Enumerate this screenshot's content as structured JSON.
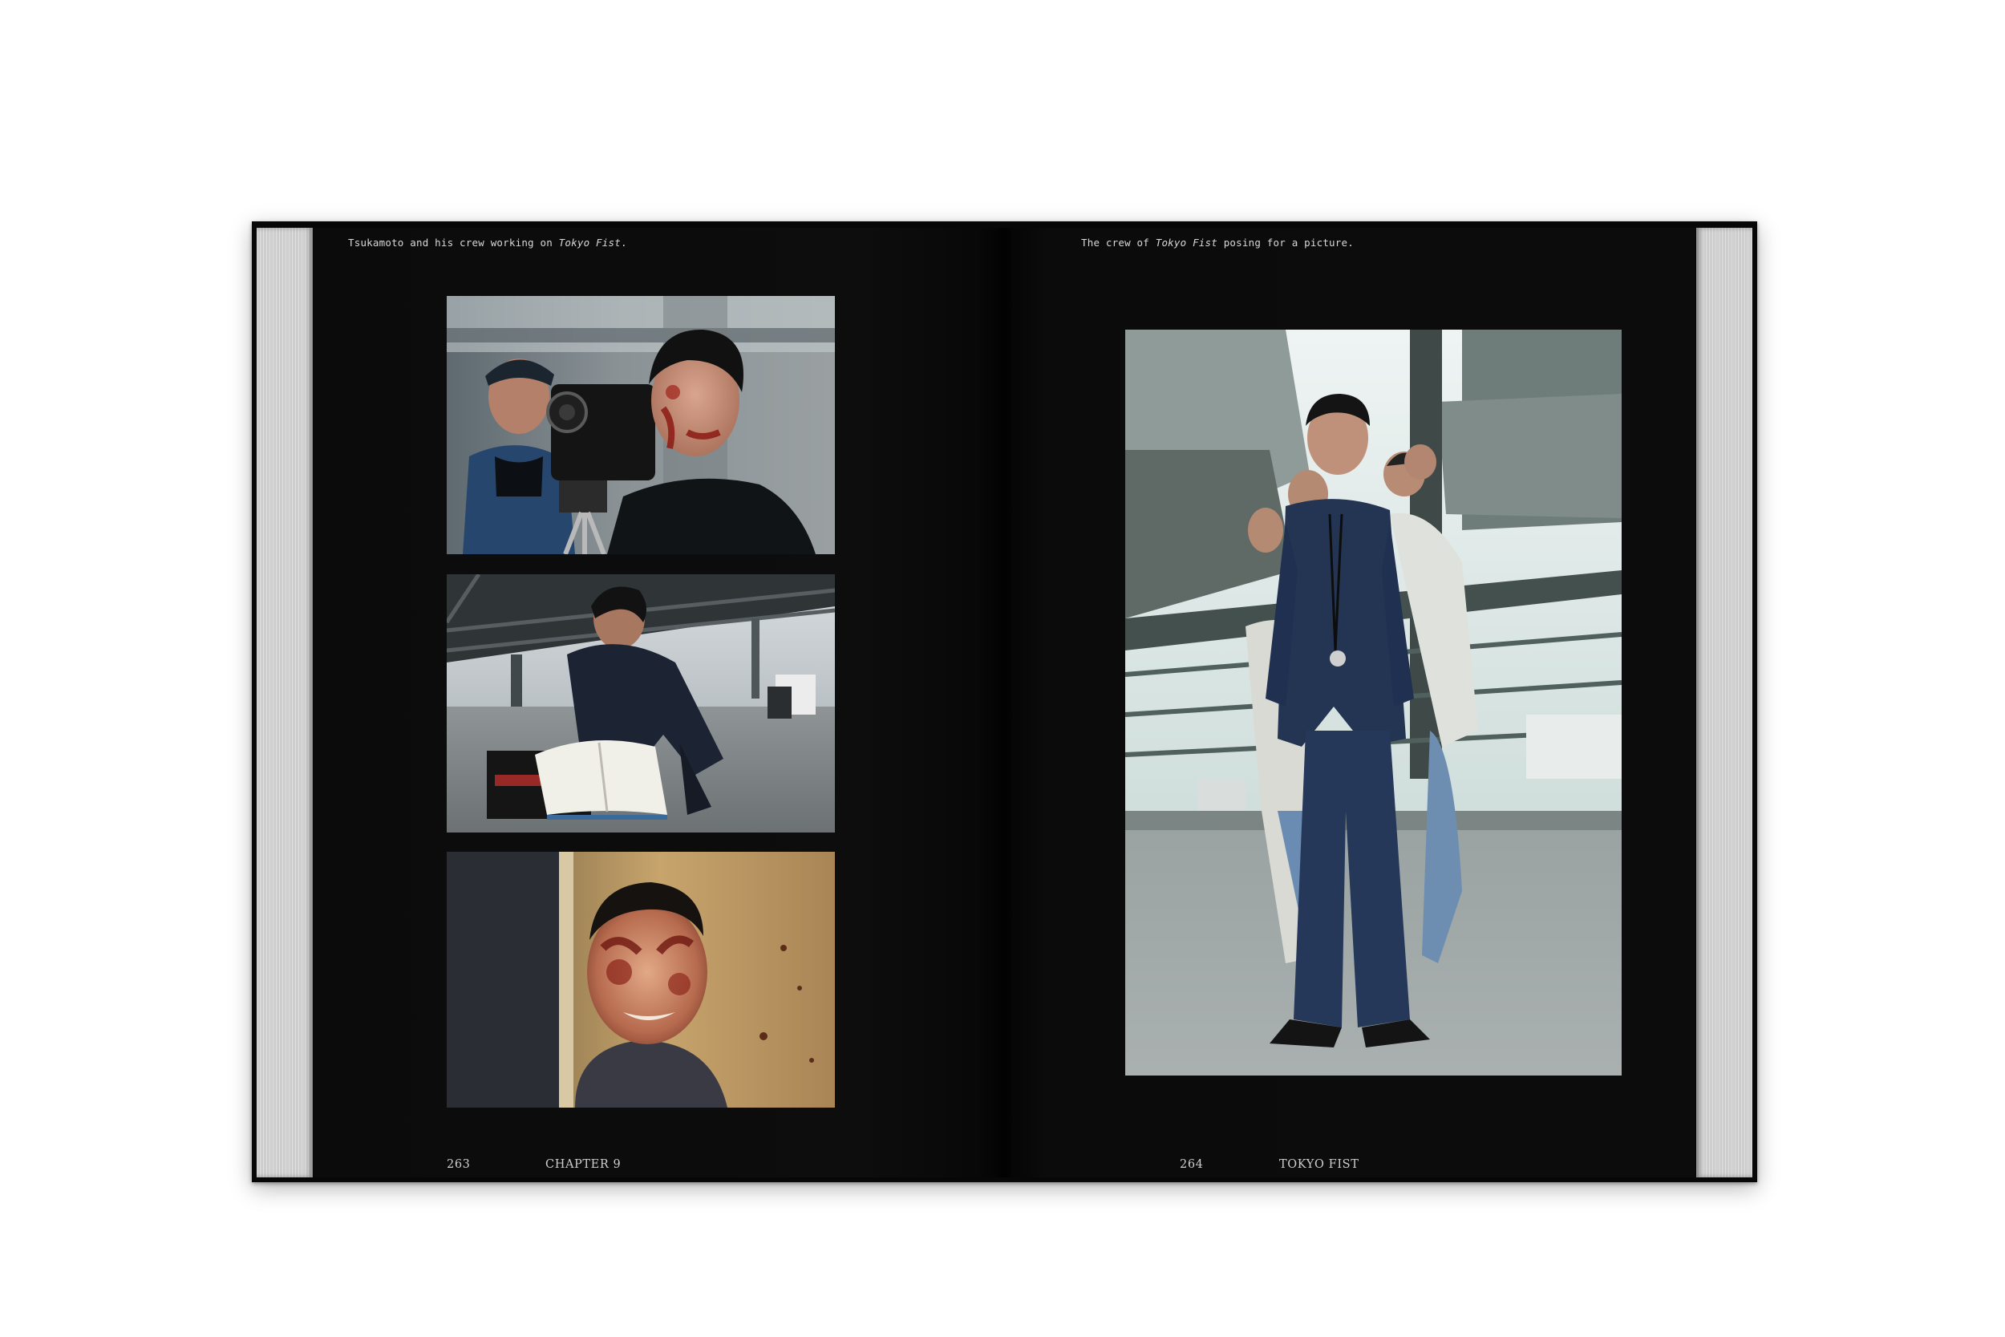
{
  "left_page": {
    "caption": {
      "before": "Tsukamoto and his crew working on ",
      "title": "Tokyo Fist",
      "after": "."
    },
    "page_number": "263",
    "running_head": "CHAPTER 9"
  },
  "right_page": {
    "caption": {
      "before": "The crew of ",
      "title": "Tokyo Fist",
      "after": " posing for a picture."
    },
    "page_number": "264",
    "running_head": "TOKYO FIST"
  },
  "colors": {
    "page_background": "#0b0b0b",
    "text": "#d8d8d8",
    "page_edges": "#d0d0d0"
  }
}
